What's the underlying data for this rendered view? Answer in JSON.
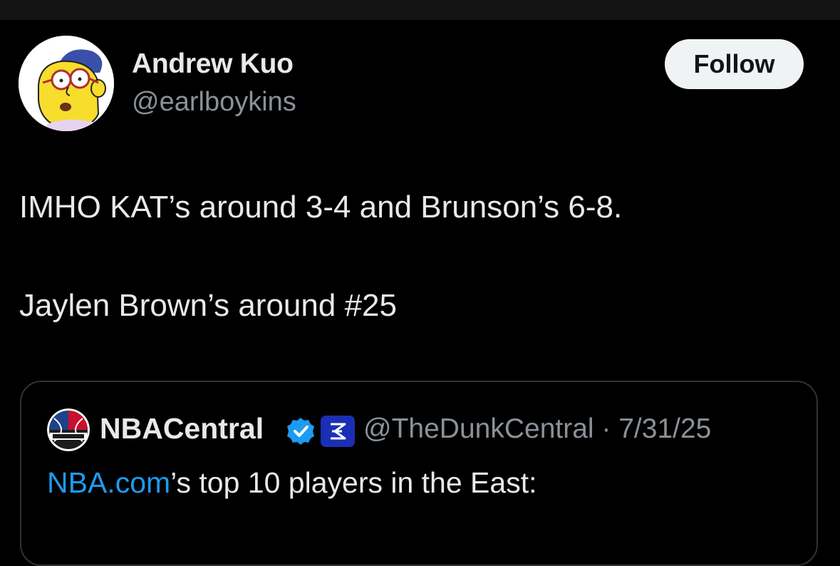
{
  "author": {
    "display_name": "Andrew Kuo",
    "handle": "@earlboykins",
    "avatar_icon": "cartoon-avatar-icon"
  },
  "follow_label": "Follow",
  "tweet": {
    "line1": "IMHO KAT’s around 3-4 and Brunson’s 6-8.",
    "line2": "Jaylen Brown’s around #25"
  },
  "quoted": {
    "display_name": "NBACentral",
    "handle": "@TheDunkCentral",
    "separator": " · ",
    "date": "7/31/25",
    "logo_icon": "nba-central-logo-icon",
    "text_link": "NBA.com",
    "text_rest": "’s top 10 players in the East:"
  },
  "colors": {
    "background": "#000000",
    "text_primary": "#e7e9ea",
    "text_secondary": "#8b9198",
    "link": "#1d9bf0",
    "verified": "#1d9bf0",
    "border": "#2f3336"
  }
}
